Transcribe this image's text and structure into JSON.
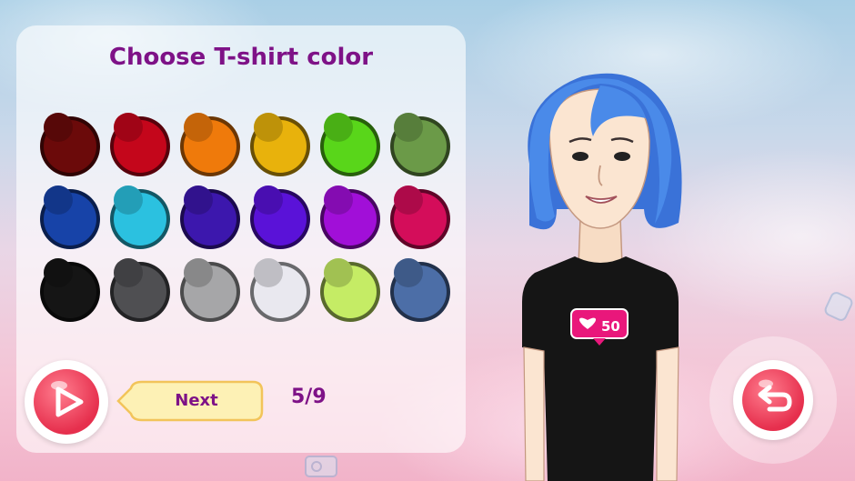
{
  "panel": {
    "title": "Choose T-shirt color",
    "swatches": [
      {
        "name": "dark-red",
        "color": "#6b0a0a"
      },
      {
        "name": "red",
        "color": "#c4061b"
      },
      {
        "name": "orange",
        "color": "#ef7a0b"
      },
      {
        "name": "yellow",
        "color": "#e8b20c"
      },
      {
        "name": "lime-green",
        "color": "#59d61a"
      },
      {
        "name": "olive-green",
        "color": "#6b9a48"
      },
      {
        "name": "navy-blue",
        "color": "#1743a8"
      },
      {
        "name": "cyan",
        "color": "#2bc1e0"
      },
      {
        "name": "indigo",
        "color": "#3c17ad"
      },
      {
        "name": "violet",
        "color": "#5a12d8"
      },
      {
        "name": "purple",
        "color": "#a10fd8"
      },
      {
        "name": "magenta",
        "color": "#d40d5a"
      },
      {
        "name": "black",
        "color": "#151515"
      },
      {
        "name": "dark-gray",
        "color": "#4f4f52"
      },
      {
        "name": "gray",
        "color": "#a6a6a8"
      },
      {
        "name": "light-gray",
        "color": "#e9e8ef"
      },
      {
        "name": "light-green",
        "color": "#c5ec65"
      },
      {
        "name": "slate-blue",
        "color": "#4c6ea7"
      }
    ],
    "next_label": "Next",
    "progress": "5/9"
  },
  "icons": {
    "play": "play-icon",
    "undo": "undo-arrow-icon"
  },
  "avatar": {
    "shirt_color": "#151515",
    "hair_color": "#3f7fe0",
    "badge_text": "50"
  },
  "colors": {
    "accent_purple": "#7e1287",
    "button_red": "#e62f4d",
    "next_button_fill": "#fdf1b5",
    "badge_pink": "#e9177b"
  }
}
